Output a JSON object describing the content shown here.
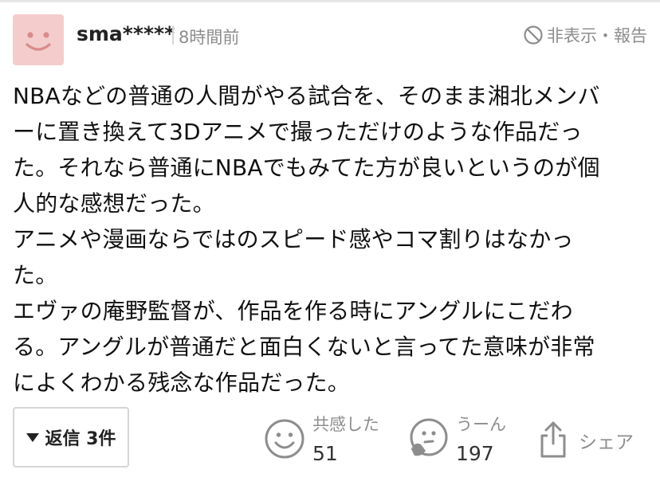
{
  "user": {
    "name": "sma*****",
    "time": "8時間前"
  },
  "header": {
    "hide_report": "非表示・報告"
  },
  "comment": {
    "lines": [
      "NBAなどの普通の人間がやる試合を、そのまま湘北メンバ",
      "ーに置き換えて3Dアニメで撮っただけのような作品だっ",
      "た。それなら普通にNBAでもみてた方が良いというのが個",
      "人的な感想だった。",
      "アニメや漫画ならではのスピード感やコマ割りはなかっ",
      "た。",
      "エヴァの庵野監督が、作品を作る時にアングルにこだわ",
      "る。アングルが普通だと面白くないと言ってた意味が非常",
      "によくわかる残念な作品だった。"
    ]
  },
  "footer": {
    "reply_label": "返信 3件",
    "empathy": {
      "label": "共感した",
      "count": "51"
    },
    "disagree": {
      "label": "うーん",
      "count": "197"
    },
    "share_label": "シェア"
  },
  "colors": {
    "avatar_bg": "#f4cccc",
    "avatar_face": "#d98b8b",
    "muted": "#8d8d8d"
  }
}
